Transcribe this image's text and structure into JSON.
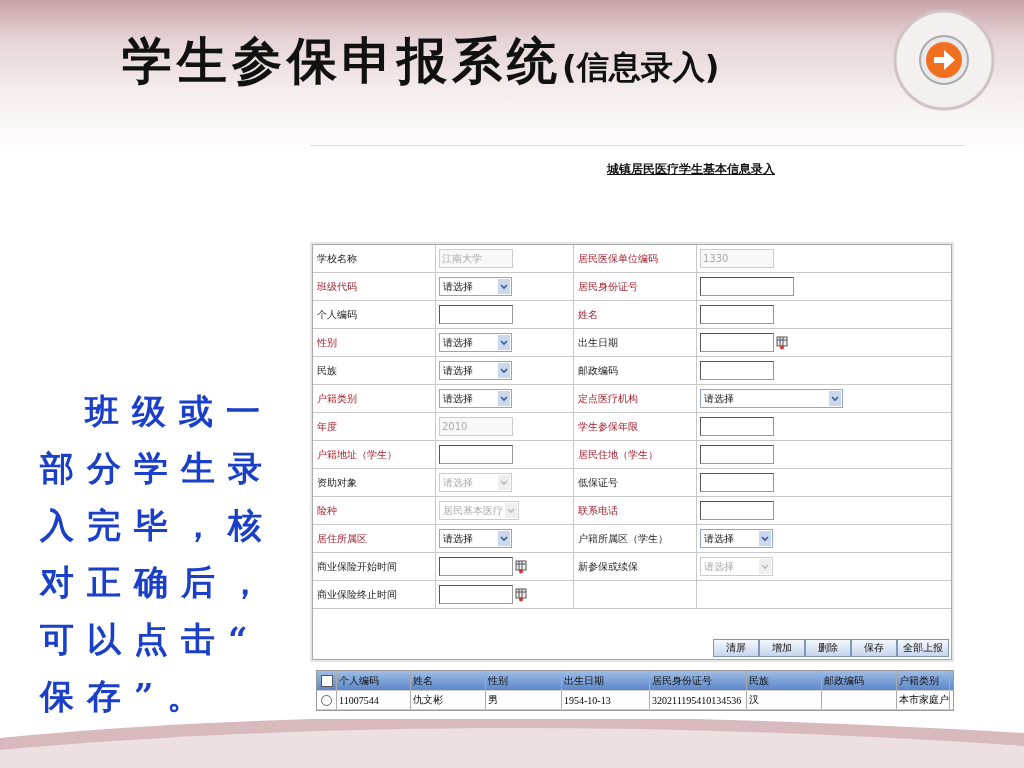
{
  "slide": {
    "title": "学生参保申报系统",
    "subtitle": "(信息录入)"
  },
  "note": "班级或一部分学生录入完毕，核对正确后，可以点击“保存”。",
  "form": {
    "title": "城镇居民医疗学生基本信息录入",
    "rows": [
      {
        "cells": [
          {
            "label": "学校名称",
            "required": false,
            "kind": "text",
            "value": "江南大学",
            "disabled": true
          },
          {
            "label": "居民医保单位编码",
            "required": true,
            "kind": "text",
            "value": "1330",
            "disabled": true
          }
        ]
      },
      {
        "cells": [
          {
            "label": "班级代码",
            "required": true,
            "kind": "select",
            "value": "请选择",
            "disabled": false
          },
          {
            "label": "居民身份证号",
            "required": true,
            "kind": "text",
            "disabled": false,
            "wide": true
          }
        ]
      },
      {
        "cells": [
          {
            "label": "个人编码",
            "required": false,
            "kind": "text",
            "disabled": false
          },
          {
            "label": "姓名",
            "required": true,
            "kind": "text",
            "disabled": false
          }
        ]
      },
      {
        "cells": [
          {
            "label": "性别",
            "required": true,
            "kind": "select",
            "value": "请选择",
            "disabled": false
          },
          {
            "label": "出生日期",
            "required": false,
            "kind": "date",
            "disabled": false
          }
        ]
      },
      {
        "cells": [
          {
            "label": "民族",
            "required": false,
            "kind": "select",
            "value": "请选择",
            "disabled": false
          },
          {
            "label": "邮政编码",
            "required": false,
            "kind": "text",
            "disabled": false
          }
        ]
      },
      {
        "cells": [
          {
            "label": "户籍类别",
            "required": true,
            "kind": "select",
            "value": "请选择",
            "disabled": false
          },
          {
            "label": "定点医疗机构",
            "required": true,
            "kind": "select",
            "value": "请选择",
            "disabled": false,
            "wide": true
          }
        ]
      },
      {
        "cells": [
          {
            "label": "年度",
            "required": true,
            "kind": "text",
            "value": "2010",
            "disabled": true
          },
          {
            "label": "学生参保年限",
            "required": true,
            "kind": "text",
            "disabled": false
          }
        ]
      },
      {
        "cells": [
          {
            "label": "户籍地址（学生）",
            "required": true,
            "kind": "text",
            "disabled": false
          },
          {
            "label": "居民住地（学生）",
            "required": true,
            "kind": "text",
            "disabled": false
          }
        ]
      },
      {
        "cells": [
          {
            "label": "资助对象",
            "required": false,
            "kind": "select",
            "value": "请选择",
            "disabled": true
          },
          {
            "label": "低保证号",
            "required": false,
            "kind": "text",
            "disabled": false
          }
        ]
      },
      {
        "cells": [
          {
            "label": "险种",
            "required": true,
            "kind": "select",
            "value": "居民基本医疗",
            "disabled": true
          },
          {
            "label": "联系电话",
            "required": true,
            "kind": "text",
            "disabled": false
          }
        ]
      },
      {
        "cells": [
          {
            "label": "居住所属区",
            "required": true,
            "kind": "select",
            "value": "请选择",
            "disabled": false
          },
          {
            "label": "户籍所属区（学生）",
            "required": false,
            "kind": "select",
            "value": "请选择",
            "disabled": false
          }
        ]
      },
      {
        "cells": [
          {
            "label": "商业保险开始时间",
            "required": false,
            "kind": "date",
            "disabled": false
          },
          {
            "label": "新参保或续保",
            "required": false,
            "kind": "select",
            "value": "请选择",
            "disabled": true
          }
        ]
      },
      {
        "cells": [
          {
            "label": "商业保险终止时间",
            "required": false,
            "kind": "date",
            "disabled": false
          }
        ]
      }
    ],
    "buttons": [
      "清屏",
      "增加",
      "删除",
      "保存",
      "全部上报"
    ]
  },
  "grid": {
    "select_all_checked": false,
    "columns": [
      "个人编码",
      "姓名",
      "性别",
      "出生日期",
      "居民身份证号",
      "民族",
      "邮政编码",
      "户籍类别"
    ],
    "rows": [
      {
        "selected": false,
        "cells": [
          "11007544",
          "仇文彬",
          "男",
          "1954-10-13",
          "320211195410134536",
          "汉",
          null,
          "本市家庭户"
        ]
      }
    ]
  }
}
